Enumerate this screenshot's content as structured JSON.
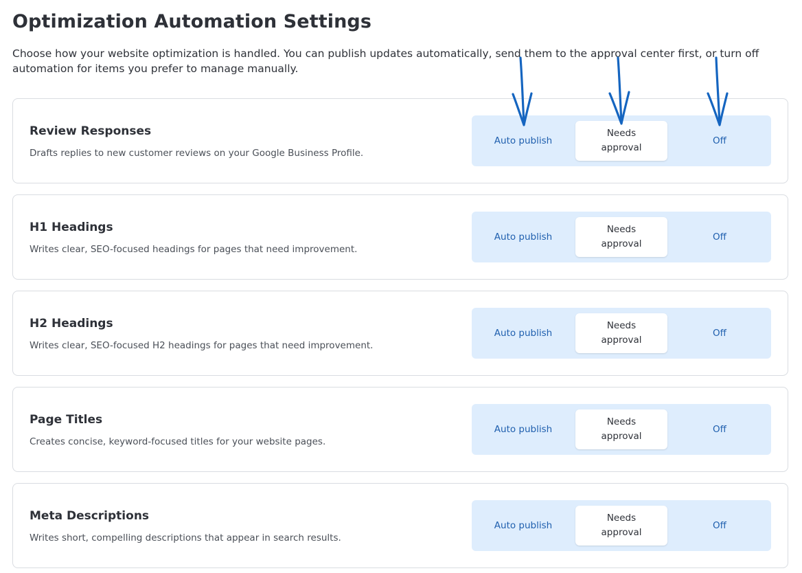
{
  "page": {
    "title": "Optimization Automation Settings",
    "description": "Choose how your website optimization is handled. You can publish updates automatically, send them to the approval center first, or turn off automation for items you prefer to manage manually."
  },
  "options": {
    "auto": "Auto publish",
    "needs_line1": "Needs",
    "needs_line2": "approval",
    "off": "Off"
  },
  "settings": [
    {
      "title": "Review Responses",
      "description": "Drafts replies to new customer reviews on your Google Business Profile.",
      "selected": "Needs approval"
    },
    {
      "title": "H1 Headings",
      "description": "Writes clear, SEO-focused headings for pages that need improvement.",
      "selected": "Needs approval"
    },
    {
      "title": "H2 Headings",
      "description": "Writes clear, SEO-focused H2 headings for pages that need improvement.",
      "selected": "Needs approval"
    },
    {
      "title": "Page Titles",
      "description": "Creates concise, keyword-focused titles for your website pages.",
      "selected": "Needs approval"
    },
    {
      "title": "Meta Descriptions",
      "description": "Writes short, compelling descriptions that appear in search results.",
      "selected": "Needs approval"
    }
  ],
  "colors": {
    "segment_bg": "#deedfd",
    "option_text": "#1f5fae",
    "annotation_arrow": "#1565c0"
  }
}
